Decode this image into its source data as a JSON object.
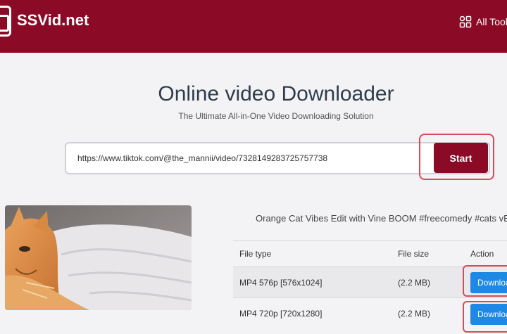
{
  "header": {
    "logo_text": "SSVid.net",
    "tools_label": "All Tools"
  },
  "hero": {
    "title": "Online video Downloader",
    "subtitle": "The Ultimate All-in-One Video Downloading Solution"
  },
  "search": {
    "value": "https://www.tiktok.com/@the_mannii/video/7328149283725757738",
    "start_label": "Start"
  },
  "result": {
    "video_title": "Orange Cat Vibes Edit with Vine BOOM #freecomedy #cats vB:@",
    "columns": [
      "File type",
      "File size",
      "Action"
    ],
    "rows": [
      {
        "type": "MP4 576p [576x1024]",
        "size": "(2.2 MB)",
        "action": "Download"
      },
      {
        "type": "MP4 720p [720x1280]",
        "size": "(2.2 MB)",
        "action": "Download"
      }
    ]
  },
  "colors": {
    "brand": "#8b0a25",
    "download": "#1e88e5",
    "highlight": "#d94a5c"
  }
}
